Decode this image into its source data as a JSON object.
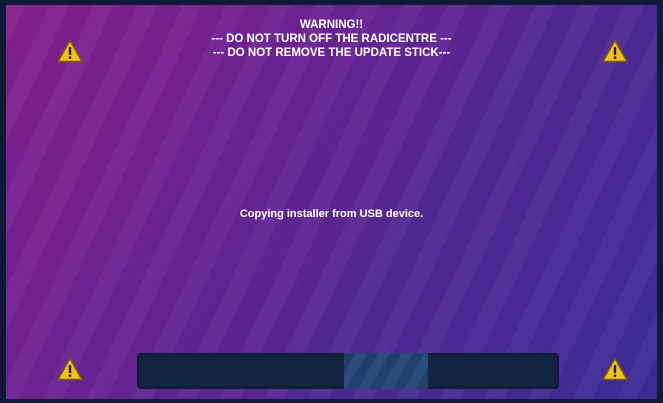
{
  "warning": {
    "title": "WARNING!!",
    "line1": "--- DO NOT TURN OFF THE RADICENTRE ---",
    "line2": "--- DO NOT REMOVE THE UPDATE STICK---"
  },
  "status": {
    "message": "Copying installer from USB device."
  },
  "progress": {
    "segment_start_fraction": 0.49,
    "segment_width_fraction": 0.2
  },
  "icons": {
    "top_left": "warning-triangle-icon",
    "top_right": "warning-triangle-icon",
    "bottom_left": "warning-triangle-icon",
    "bottom_right": "warning-triangle-icon"
  },
  "colors": {
    "background_start": "#86208e",
    "background_end": "#3b2d96",
    "frame": "#0f1a38",
    "progress_track": "#132541",
    "progress_fill": "#21406c",
    "warning_yellow": "#f2c21b"
  }
}
